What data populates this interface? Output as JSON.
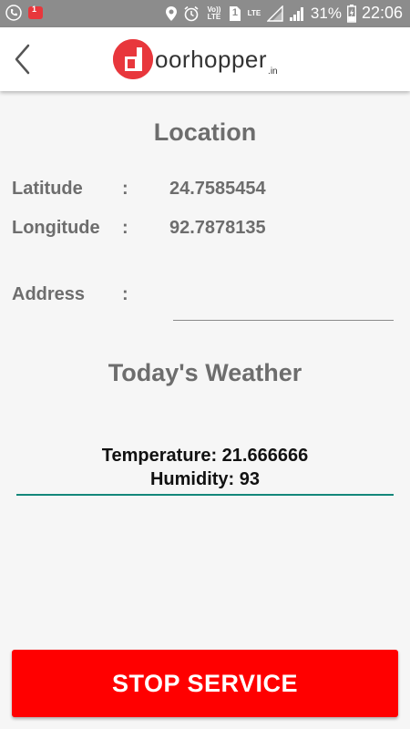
{
  "status_bar": {
    "notification_badge": "1",
    "volte_label": "Vo)) LTE",
    "sim_label": "1",
    "lte_label": "LTE",
    "battery_percent": "31%",
    "time": "22:06"
  },
  "app_bar": {
    "logo_text": "oorhopper",
    "logo_suffix": ".in"
  },
  "location": {
    "title": "Location",
    "latitude_label": "Latitude",
    "latitude_colon": ":",
    "latitude_value": "24.7585454",
    "longitude_label": "Longitude",
    "longitude_colon": ":",
    "longitude_value": "92.7878135",
    "address_label": "Address",
    "address_colon": ":"
  },
  "weather": {
    "title": "Today's Weather",
    "temperature_text": "Temperature: 21.666666",
    "humidity_text": "Humidity: 93"
  },
  "actions": {
    "stop_service_label": "STOP SERVICE"
  },
  "colors": {
    "accent_red": "#ff0000",
    "logo_red": "#e8373c",
    "underline_teal": "#13877a",
    "text_gray": "#6d6d6d"
  }
}
